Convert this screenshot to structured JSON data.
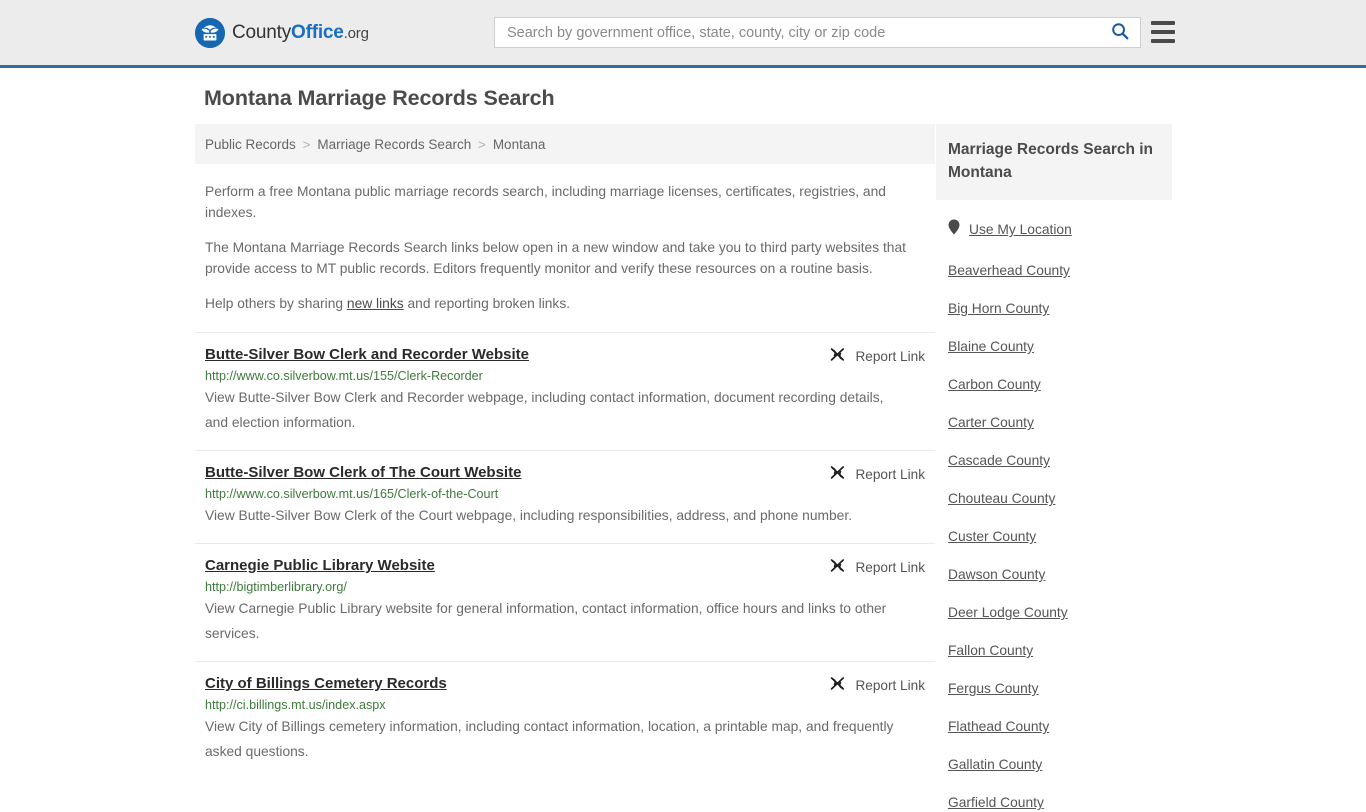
{
  "header": {
    "logo": {
      "part1": "County",
      "part2": "Office",
      "part3": ".org",
      "icon": "eagle-shield-icon"
    },
    "search": {
      "placeholder": "Search by government office, state, county, city or zip code",
      "value": "",
      "icon": "search-icon"
    },
    "menu_icon": "hamburger-menu-icon",
    "accent_color": "#2f6ea5",
    "background_color": "#ececec"
  },
  "page": {
    "title": "Montana Marriage Records Search"
  },
  "breadcrumb": {
    "items": [
      {
        "label": "Public Records"
      },
      {
        "label": "Marriage Records Search"
      },
      {
        "label": "Montana"
      }
    ],
    "separator": ">"
  },
  "intro": {
    "p1": "Perform a free Montana public marriage records search, including marriage licenses, certificates, registries, and indexes.",
    "p2": "The Montana Marriage Records Search links below open in a new window and take you to third party websites that provide access to MT public records. Editors frequently monitor and verify these resources on a routine basis.",
    "p3_prefix": "Help others by sharing ",
    "p3_link": "new links",
    "p3_suffix": " and reporting broken links."
  },
  "results": {
    "report_label": "Report Link",
    "report_icon": "broken-link-icon",
    "url_color": "#3f7a3c",
    "items": [
      {
        "title": "Butte-Silver Bow Clerk and Recorder Website",
        "url": "http://www.co.silverbow.mt.us/155/Clerk-Recorder",
        "description": "View Butte-Silver Bow Clerk and Recorder webpage, including contact information, document recording details, and election information."
      },
      {
        "title": "Butte-Silver Bow Clerk of The Court Website",
        "url": "http://www.co.silverbow.mt.us/165/Clerk-of-the-Court",
        "description": "View Butte-Silver Bow Clerk of the Court webpage, including responsibilities, address, and phone number."
      },
      {
        "title": "Carnegie Public Library Website",
        "url": "http://bigtimberlibrary.org/",
        "description": "View Carnegie Public Library website for general information, contact information, office hours and links to other services."
      },
      {
        "title": "City of Billings Cemetery Records",
        "url": "http://ci.billings.mt.us/index.aspx",
        "description": "View City of Billings cemetery information, including contact information, location, a printable map, and frequently asked questions."
      }
    ]
  },
  "sidebar": {
    "heading": "Marriage Records Search in Montana",
    "use_location": {
      "label": "Use My Location",
      "icon": "map-pin-icon"
    },
    "counties": [
      {
        "label": "Beaverhead County"
      },
      {
        "label": "Big Horn County"
      },
      {
        "label": "Blaine County"
      },
      {
        "label": "Carbon County"
      },
      {
        "label": "Carter County"
      },
      {
        "label": "Cascade County"
      },
      {
        "label": "Chouteau County"
      },
      {
        "label": "Custer County"
      },
      {
        "label": "Dawson County"
      },
      {
        "label": "Deer Lodge County"
      },
      {
        "label": "Fallon County"
      },
      {
        "label": "Fergus County"
      },
      {
        "label": "Flathead County"
      },
      {
        "label": "Gallatin County"
      },
      {
        "label": "Garfield County"
      }
    ]
  }
}
